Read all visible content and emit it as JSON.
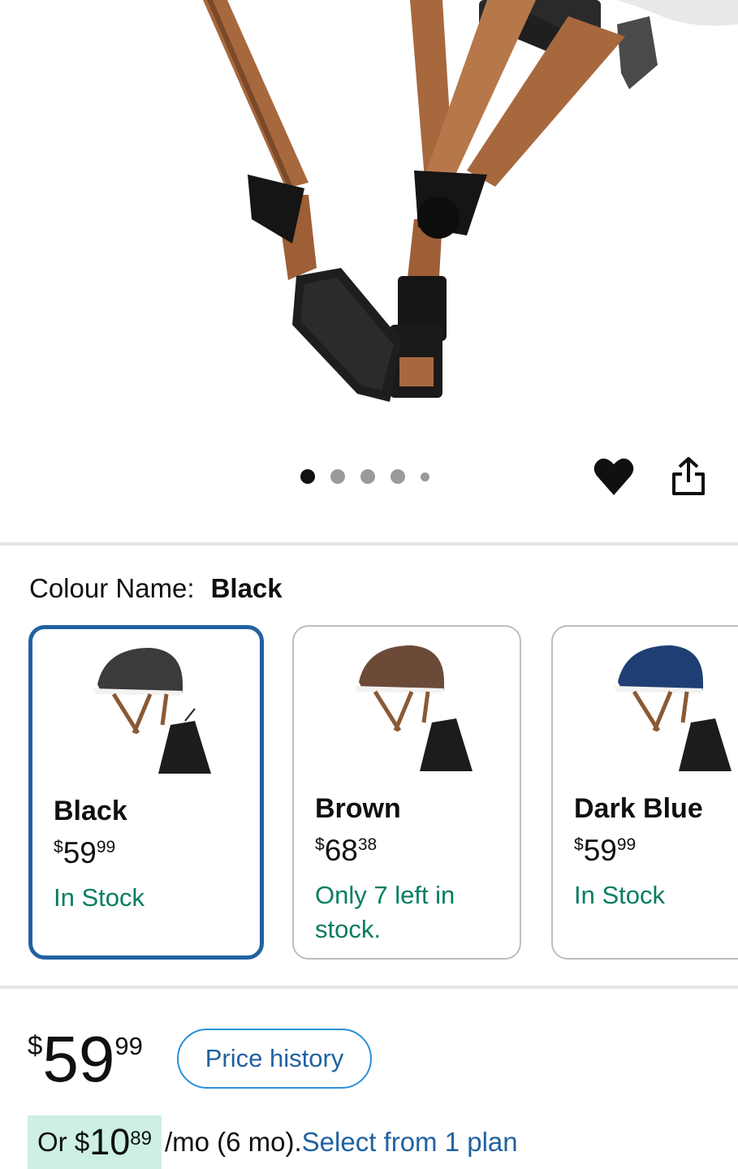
{
  "product": {
    "image_alt": "helmet strap detail",
    "image_count": 5,
    "active_image_index": 0
  },
  "actions": {
    "wishlist_icon": "heart-icon",
    "share_icon": "share-icon"
  },
  "colour": {
    "label": "Colour Name:",
    "selected": "Black"
  },
  "swatches": [
    {
      "name": "Black",
      "currency": "$",
      "price_whole": "59",
      "price_fraction": "99",
      "stock": "In Stock",
      "helmet_color": "#3a3b3d"
    },
    {
      "name": "Brown",
      "currency": "$",
      "price_whole": "68",
      "price_fraction": "38",
      "stock": "Only 7 left in stock.",
      "helmet_color": "#6b4a38"
    },
    {
      "name": "Dark Blue",
      "currency": "$",
      "price_whole": "59",
      "price_fraction": "99",
      "stock": "In Stock",
      "helmet_color": "#1f3f74"
    }
  ],
  "price": {
    "currency": "$",
    "whole": "59",
    "fraction": "99",
    "history_label": "Price history"
  },
  "installment": {
    "prefix": "Or ",
    "currency": "$",
    "whole": "10",
    "fraction": "89",
    "term": "/mo (6 mo).",
    "link": "Select from 1 plan"
  },
  "colors": {
    "accent_link": "#2162a1",
    "in_stock": "#067d62",
    "selected_border": "#2162a1",
    "installment_bg": "#cdefe4"
  }
}
